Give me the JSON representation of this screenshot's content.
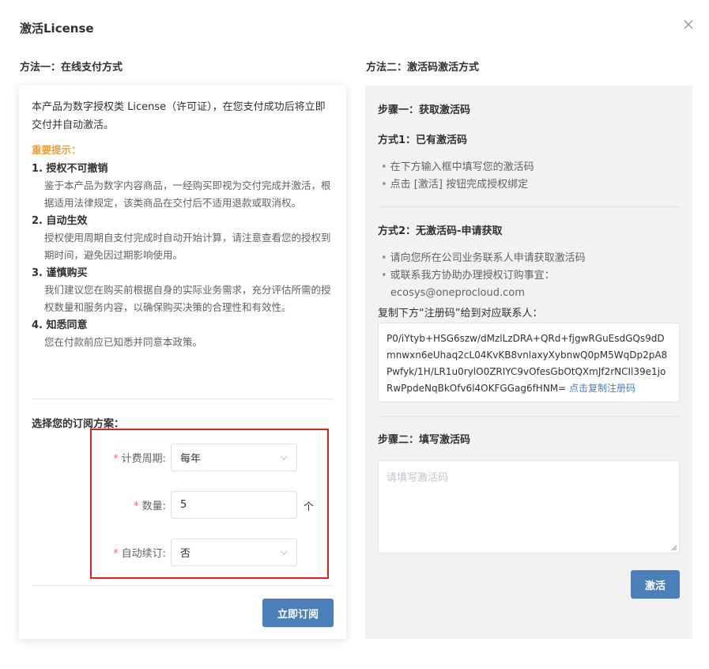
{
  "dialog": {
    "title": "激活License"
  },
  "method1": {
    "heading": "方法一：在线支付方式",
    "intro": "本产品为数字授权类 License（许可证），在您支付成功后将立即交付并自动激活。",
    "important_label": "重要提示：",
    "rules": [
      {
        "title": "1. 授权不可撤销",
        "body": "鉴于本产品为数字内容商品，一经购买即视为交付完成并激活，根据适用法律规定，该类商品在交付后不适用退款或取消权。"
      },
      {
        "title": "2. 自动生效",
        "body": "授权使用周期自支付完成时自动开始计算，请注意查看您的授权到期时间，避免因过期影响使用。"
      },
      {
        "title": "3. 谨慎购买",
        "body": "我们建议您在购买前根据自身的实际业务需求，充分评估所需的授权数量和服务内容，以确保购买决策的合理性和有效性。"
      },
      {
        "title": "4. 知悉同意",
        "body": "您在付款前应已知悉并同意本政策。"
      }
    ],
    "choose_label": "选择您的订阅方案：",
    "form": {
      "required_mark": "*",
      "billing_label": "计费周期:",
      "billing_value": "每年",
      "quantity_label": "数量:",
      "quantity_value": "5",
      "quantity_unit": "个",
      "renew_label": "自动续订:",
      "renew_value": "否"
    },
    "subscribe_button": "立即订阅"
  },
  "method2": {
    "heading": "方法二：激活码激活方式",
    "step1": "步骤一：获取激活码",
    "way1_title": "方式1：已有激活码",
    "way1_bullets": [
      "在下方输入框中填写您的激活码",
      "点击 [激活] 按钮完成授权绑定"
    ],
    "way2_title": "方式2：无激活码-申请获取",
    "way2_bullets": [
      "请向您所在公司业务联系人申请获取激活码",
      "或联系我方协助办理授权订购事宜："
    ],
    "contact_email": "ecosys@oneprocloud.com",
    "copy_instruction": "复制下方“注册码”给到对应联系人：",
    "registration_code": "P0/iYtyb+HSG6szw/dMzlLzDRA+QRd+fjgwRGuEsdGQs9dDmnwxn6eUhaq2cL04KvKB8vnlaxyXybnwQ0pM5WqDp2pA8Pwfyk/1H/LR1u0rylO0ZRIYC9vOfesGbOtQXmJf2rNCIl39e1joRwPpdeNqBkOfv6l4OKFGGag6fHNM=",
    "copy_link": "点击复制注册码",
    "step2": "步骤二：填写激活码",
    "code_placeholder": "请填写激活码",
    "activate_button": "激活"
  },
  "colors": {
    "primary": "#4a7fb9",
    "warning": "#e6a23c",
    "highlight_box": "#e02020",
    "required": "#f56c6c"
  },
  "icons": {
    "close": "close-icon",
    "dropdown": "chevron-down-icon"
  }
}
